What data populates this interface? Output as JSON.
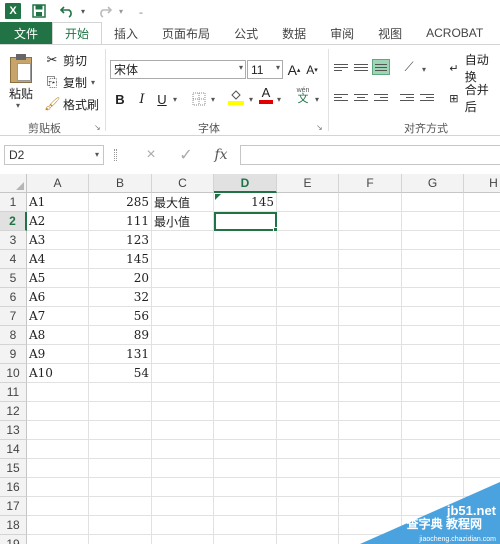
{
  "quick_access": {
    "logo": "X",
    "save_icon": "save-icon",
    "undo_icon": "undo-icon",
    "redo_icon": "redo-icon",
    "customize_icon": "customize-icon"
  },
  "tabs": [
    {
      "label": "文件",
      "kind": "file"
    },
    {
      "label": "开始",
      "kind": "active"
    },
    {
      "label": "插入"
    },
    {
      "label": "页面布局"
    },
    {
      "label": "公式"
    },
    {
      "label": "数据"
    },
    {
      "label": "审阅"
    },
    {
      "label": "视图"
    },
    {
      "label": "ACROBAT"
    }
  ],
  "ribbon": {
    "clipboard": {
      "paste_label": "粘贴",
      "cut_label": "剪切",
      "copy_label": "复制",
      "format_painter_label": "格式刷",
      "group_label": "剪贴板"
    },
    "font": {
      "font_name": "宋体",
      "font_size": "11",
      "bold": "B",
      "italic": "I",
      "underline": "U",
      "increase_size": "A",
      "decrease_size": "A",
      "font_color_letter": "A",
      "phonetic_label": "wén",
      "phonetic_char": "文",
      "group_label": "字体",
      "fill_color": "#ffff00",
      "font_color": "#e00000"
    },
    "alignment": {
      "wrap_text_label": "自动换",
      "merge_label": "合并后",
      "group_label": "对齐方式"
    }
  },
  "formula_bar": {
    "name_box": "D2",
    "cancel_icon": "×",
    "enter_icon": "✓",
    "fx_label": "fx",
    "formula": ""
  },
  "grid": {
    "columns": [
      "A",
      "B",
      "C",
      "D",
      "E",
      "F",
      "G",
      "H"
    ],
    "active_column": "D",
    "active_row": 2,
    "rows": [
      1,
      2,
      3,
      4,
      5,
      6,
      7,
      8,
      9,
      10,
      11,
      12,
      13,
      14,
      15,
      16,
      17,
      18,
      19
    ],
    "cells": {
      "A": [
        "A1",
        "A2",
        "A3",
        "A4",
        "A5",
        "A6",
        "A7",
        "A8",
        "A9",
        "A10"
      ],
      "B": [
        "285",
        "111",
        "123",
        "145",
        "20",
        "32",
        "56",
        "89",
        "131",
        "54"
      ],
      "C1": "最大值",
      "C2": "最小值",
      "D1": "145"
    },
    "accent_color": "#217346"
  },
  "watermark": {
    "line1": "jb51.net",
    "line2": "查字典 教程网",
    "line3": "jiaocheng.chazidian.com"
  }
}
